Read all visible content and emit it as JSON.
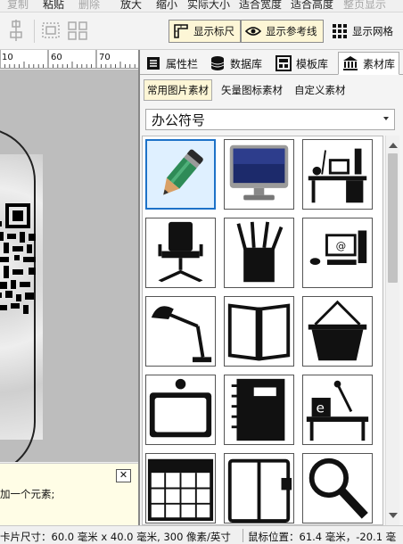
{
  "menu": {
    "items": [
      {
        "label": "复制",
        "disabled": true
      },
      {
        "label": "粘贴",
        "disabled": false
      },
      {
        "label": "删除",
        "disabled": true
      },
      {
        "label": "放大",
        "disabled": false
      },
      {
        "label": "缩小",
        "disabled": false
      },
      {
        "label": "实际大小",
        "disabled": false
      },
      {
        "label": "适合宽度",
        "disabled": false
      },
      {
        "label": "适合高度",
        "disabled": false
      },
      {
        "label": "整页显示",
        "disabled": true
      }
    ]
  },
  "toolbar": {
    "show_ruler": "显示标尺",
    "show_guides": "显示参考线",
    "show_grid": "显示网格"
  },
  "ruler": {
    "labels": [
      "10",
      "",
      "60",
      "70"
    ]
  },
  "hint": {
    "text": "加一个元素;",
    "close": "✕"
  },
  "panel": {
    "tabs": [
      "属性栏",
      "数据库",
      "模板库",
      "素材库"
    ],
    "active_tab": "素材库",
    "subtabs": [
      "常用图片素材",
      "矢量图标素材",
      "自定义素材"
    ],
    "active_subtab": "常用图片素材",
    "category": "办公符号",
    "icons": [
      {
        "name": "pencil-clipart-icon",
        "selected": true
      },
      {
        "name": "monitor-clipart-icon",
        "selected": false
      },
      {
        "name": "office-desk-computer-icon",
        "selected": false
      },
      {
        "name": "office-chair-icon",
        "selected": false
      },
      {
        "name": "pen-holder-icon",
        "selected": false
      },
      {
        "name": "computer-workstation-icon",
        "selected": false
      },
      {
        "name": "desk-lamp-icon",
        "selected": false
      },
      {
        "name": "notebook-open-icon",
        "selected": false
      },
      {
        "name": "basket-icon",
        "selected": false
      },
      {
        "name": "frame-board-icon",
        "selected": false
      },
      {
        "name": "spiral-notebook-icon",
        "selected": false
      },
      {
        "name": "desk-with-lamp-icon",
        "selected": false
      },
      {
        "name": "calendar-icon",
        "selected": false
      },
      {
        "name": "planner-binder-icon",
        "selected": false
      },
      {
        "name": "magnifier-icon",
        "selected": false
      }
    ]
  },
  "status": {
    "card_size": "卡片尺寸：60.0 毫米 x 40.0 毫米, 300 像素/英寸",
    "mouse_pos": "鼠标位置：61.4 毫米，-20.1 毫"
  }
}
